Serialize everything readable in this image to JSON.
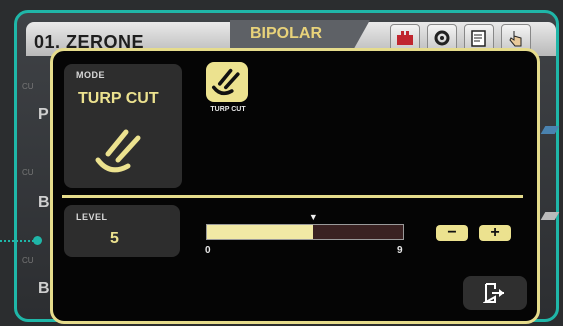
{
  "header": {
    "preset_name": "01. ZERONE",
    "mode_tab": "BIPOLAR",
    "buttons": [
      {
        "icon": "device-settings-icon"
      },
      {
        "icon": "gear-icon"
      },
      {
        "icon": "edit-note-icon"
      },
      {
        "icon": "hand-pointer-icon"
      }
    ]
  },
  "background_rows": [
    {
      "letter": "P",
      "tag": "CU"
    },
    {
      "letter": "B",
      "tag": "CU"
    },
    {
      "letter": "B",
      "tag": "CU"
    }
  ],
  "modal": {
    "mode_caption": "MODE",
    "mode_value": "TURP CUT",
    "mode_icon": "cut-electrode-icon",
    "options": [
      {
        "label": "TURP CUT",
        "icon": "cut-electrode-icon",
        "selected": true
      }
    ],
    "level_caption": "LEVEL",
    "level_value": "5",
    "level": {
      "value": 5,
      "min": 0,
      "max": 9,
      "min_label": "0",
      "max_label": "9",
      "fill_fraction": 0.54
    },
    "minus_label": "−",
    "plus_label": "+",
    "exit_icon": "exit-icon"
  },
  "colors": {
    "frame": "#1fb6a8",
    "modal_border": "#e6dc8c",
    "accent": "#ece28f",
    "modal_bg": "#050505"
  }
}
